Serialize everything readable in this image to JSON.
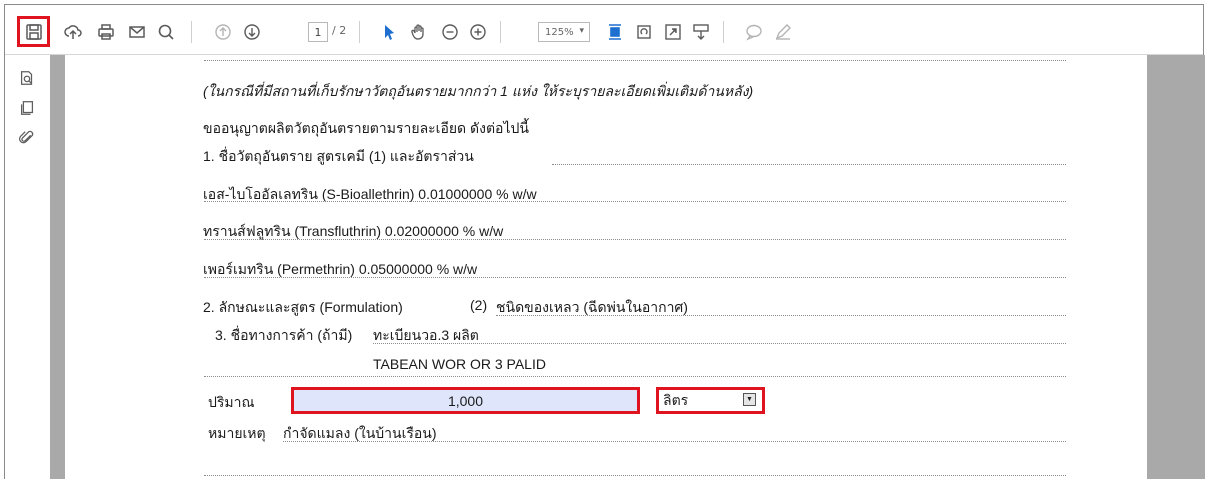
{
  "toolbar": {
    "page_current": "1",
    "page_total": "/ 2",
    "zoom_value": "125%",
    "zoom_caret": "▾",
    "icons": [
      "save-icon",
      "upload-icon",
      "print-icon",
      "email-icon",
      "search-icon",
      "prev-page-icon",
      "next-page-icon",
      "select-tool-icon",
      "hand-tool-icon",
      "zoom-out-icon",
      "zoom-in-icon",
      "fit-page-icon",
      "rotate-icon",
      "fullscreen-icon",
      "form-fields-icon",
      "comment-icon",
      "sign-icon"
    ]
  },
  "sidebar": {
    "icons": [
      "bookmark-search-icon",
      "page-thumbnails-icon",
      "attachments-icon"
    ],
    "collapse_glyph": "◀"
  },
  "document": {
    "note_italic": "(ในกรณีที่มีสถานที่เก็บรักษาวัตถุอันตรายมากกว่า 1 แห่ง ให้ระบุรายละเอียดเพิ่มเติมด้านหลัง)",
    "request_line": "ขออนุญาตผลิตวัตถุอันตรายตามรายละเอียด ดังต่อไปนี้",
    "item1_label": "1. ชื่อวัตถุอันตราย  สูตรเคมี   (1)  และอัตราส่วน",
    "ingredients": [
      "เอส-ไบโออัลเลทริน (S-Bioallethrin) 0.01000000 % w/w",
      "ทรานส์ฟลูทริน (Transfluthrin) 0.02000000 % w/w",
      "เพอร์เมทริน (Permethrin) 0.05000000 % w/w"
    ],
    "item2_label": "2. ลักษณะและสูตร (Formulation)",
    "item2_ref": "(2)",
    "item2_value": "ชนิดของเหลว (ฉีดพ่นในอากาศ)",
    "item3_label": "3. ชื่อทางการค้า (ถ้ามี)",
    "item3_value_thai": "ทะเบียนวอ.3 ผลิต",
    "item3_value_en": "TABEAN WOR OR 3 PALID",
    "quantity_label": "ปริมาณ",
    "quantity_value": "1,000",
    "unit_value": "ลิตร",
    "unit_button": "▼",
    "remark_label": "หมายเหตุ",
    "remark_value": "กำจัดแมลง (ในบ้านเรือน)"
  },
  "colors": {
    "highlight": "#e0141e",
    "field_fill": "#dfe6fb",
    "viewer_bg": "#a9a9a9",
    "accent_blue": "#1e6fd0"
  }
}
